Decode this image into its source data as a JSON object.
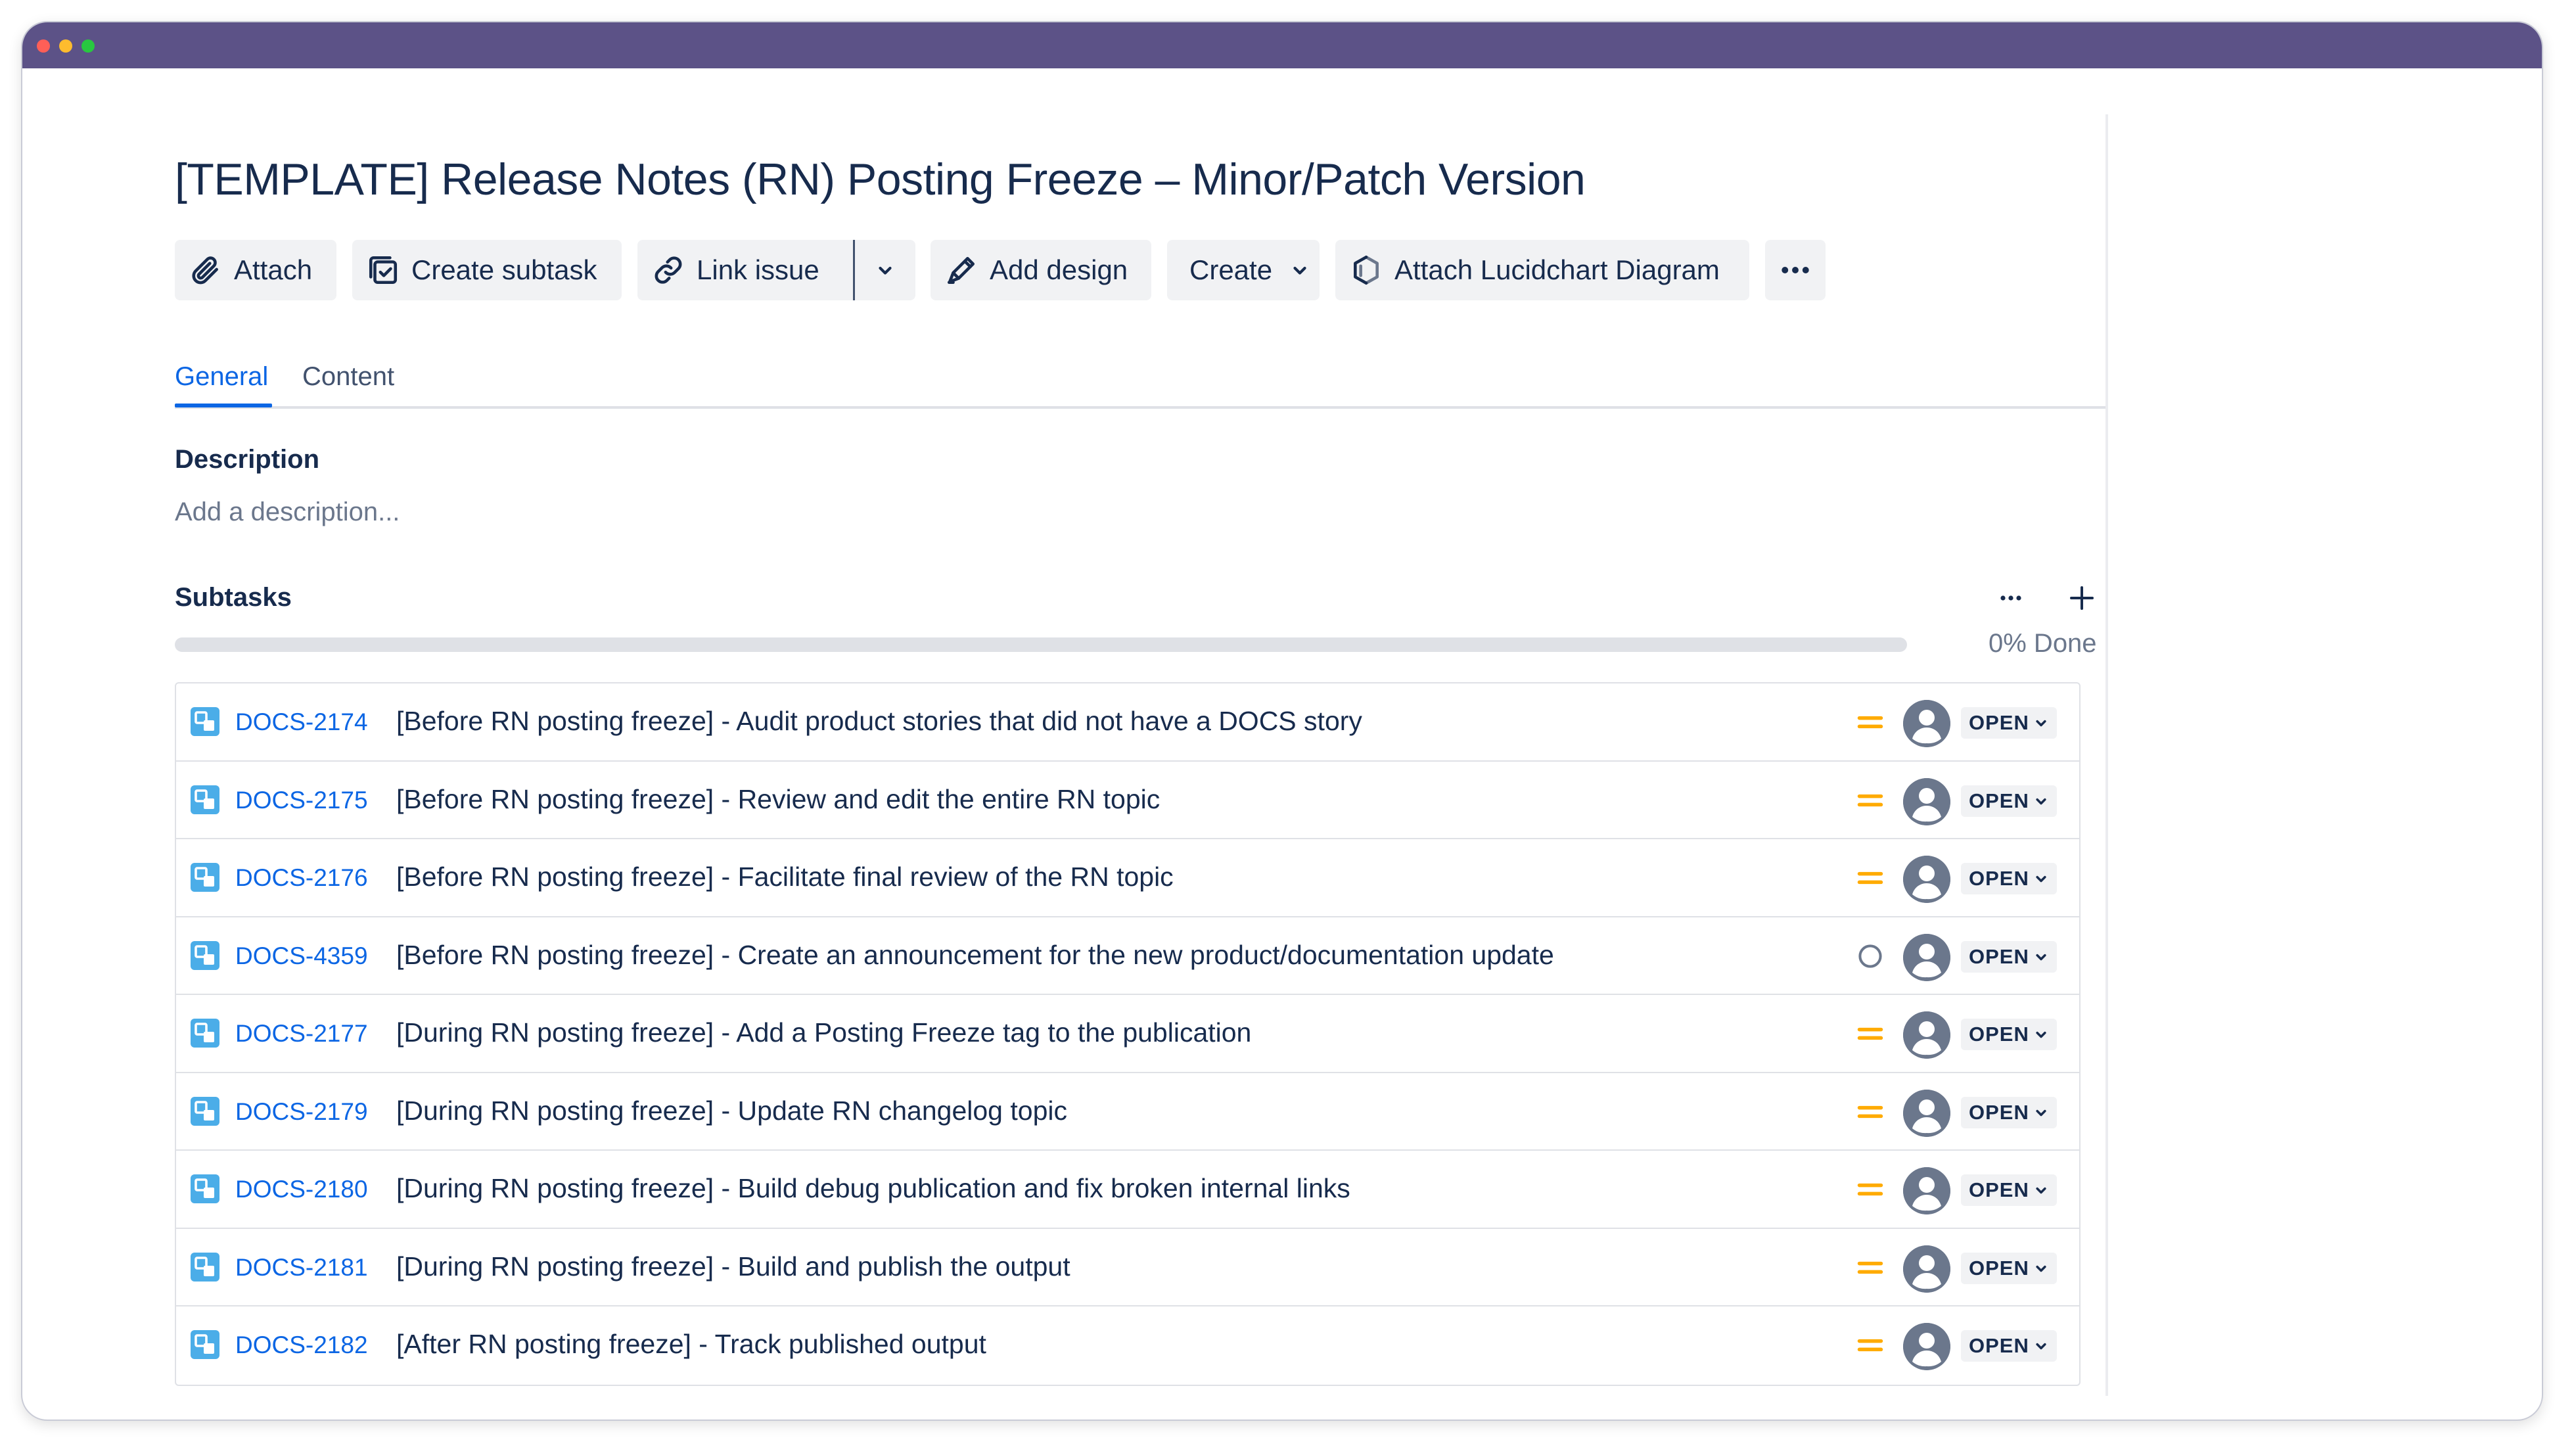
{
  "issue": {
    "title": "[TEMPLATE] Release Notes (RN) Posting Freeze – Minor/Patch Version"
  },
  "toolbar": {
    "attach": "Attach",
    "create_subtask": "Create subtask",
    "link_issue": "Link issue",
    "add_design": "Add design",
    "create": "Create",
    "attach_lucidchart": "Attach Lucidchart Diagram"
  },
  "tabs": [
    {
      "label": "General",
      "active": true
    },
    {
      "label": "Content",
      "active": false
    }
  ],
  "description": {
    "label": "Description",
    "placeholder": "Add a description..."
  },
  "subtasks": {
    "label": "Subtasks",
    "progress_percent": 0,
    "progress_text": "0% Done",
    "items": [
      {
        "key": "DOCS-2174",
        "summary": "[Before RN posting freeze] - Audit product stories that did not have a DOCS story",
        "priority": "medium",
        "status": "OPEN"
      },
      {
        "key": "DOCS-2175",
        "summary": "[Before RN posting freeze] - Review and edit the entire RN topic",
        "priority": "medium",
        "status": "OPEN"
      },
      {
        "key": "DOCS-2176",
        "summary": "[Before RN posting freeze] - Facilitate final review of the RN topic",
        "priority": "medium",
        "status": "OPEN"
      },
      {
        "key": "DOCS-4359",
        "summary": "[Before RN posting freeze] - Create an announcement for the new product/documentation update",
        "priority": "none",
        "status": "OPEN"
      },
      {
        "key": "DOCS-2177",
        "summary": "[During RN posting freeze] - Add a Posting Freeze tag to the publication",
        "priority": "medium",
        "status": "OPEN"
      },
      {
        "key": "DOCS-2179",
        "summary": "[During RN posting freeze] - Update RN changelog topic",
        "priority": "medium",
        "status": "OPEN"
      },
      {
        "key": "DOCS-2180",
        "summary": "[During RN posting freeze] - Build debug publication and fix broken internal links",
        "priority": "medium",
        "status": "OPEN"
      },
      {
        "key": "DOCS-2181",
        "summary": "[During RN posting freeze] - Build and publish the output",
        "priority": "medium",
        "status": "OPEN"
      },
      {
        "key": "DOCS-2182",
        "summary": "[After RN posting freeze] - Track published output",
        "priority": "medium",
        "status": "OPEN"
      }
    ]
  },
  "colors": {
    "titlebar": "#5c5287",
    "link": "#0c66e4",
    "priority_medium": "#ffab00",
    "text": "#172b4d",
    "muted": "#6b778c"
  },
  "icons": {
    "attach": "paperclip-icon",
    "create_subtask": "subtask-checkbox-icon",
    "link_issue": "link-icon",
    "add_design": "pen-icon",
    "lucidchart": "lucidchart-icon",
    "more": "more-icon",
    "add": "plus-icon",
    "subtask_type": "subtask-type-icon",
    "priority_medium": "priority-medium-icon",
    "priority_none": "priority-none-icon",
    "avatar": "unassigned-avatar-icon"
  }
}
